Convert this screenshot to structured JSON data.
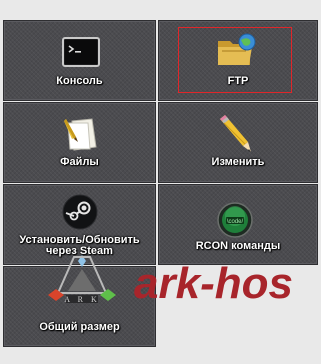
{
  "tiles": {
    "console": {
      "label": "Консоль",
      "icon": "terminal-icon"
    },
    "ftp": {
      "label": "FTP",
      "icon": "ftp-folder-icon"
    },
    "files": {
      "label": "Файлы",
      "icon": "files-icon"
    },
    "edit": {
      "label": "Изменить",
      "icon": "pencil-icon"
    },
    "steam": {
      "label_line1": "Установить/Обновить",
      "label_line2": "через Steam",
      "icon": "steam-icon"
    },
    "rcon": {
      "label": "RCON команды",
      "icon": "rcon-icon"
    },
    "size": {
      "label": "Общий размер",
      "icon": "ark-logo-icon"
    }
  },
  "watermark": {
    "text": "ark-hos"
  },
  "colors": {
    "tile_bg": "#4b4b4f",
    "highlight": "#e0262a",
    "watermark": "#a8252b"
  }
}
